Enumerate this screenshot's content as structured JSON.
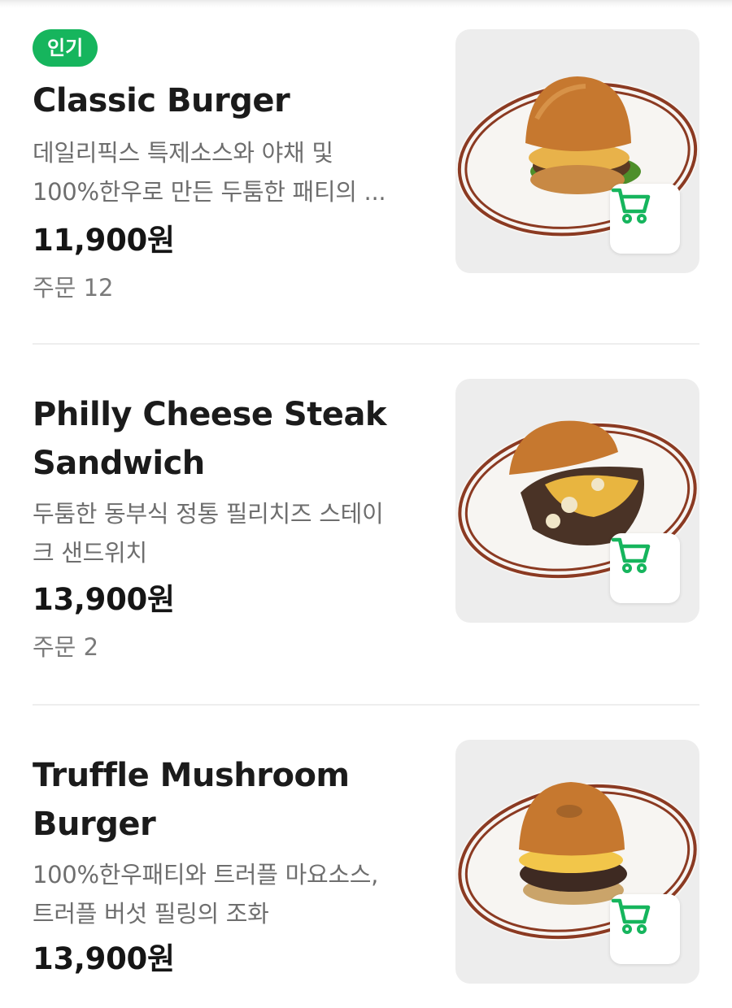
{
  "accent_color": "#16b55d",
  "menu": {
    "items": [
      {
        "badge": "인기",
        "name_lines": [
          "Classic Burger"
        ],
        "desc_lines": [
          "데일리픽스 특제소스와 야채 및",
          "100%한우로 만든 두툼한 패티의 ..."
        ],
        "price": "11,900원",
        "orders": "주문 12",
        "image_icon": "burger-photo",
        "cart_icon": "cart-icon"
      },
      {
        "name_lines": [
          "Philly Cheese Steak",
          "Sandwich"
        ],
        "desc_lines": [
          "두툼한 동부식 정통 필리치즈 스테이",
          "크 샌드위치"
        ],
        "price": "13,900원",
        "orders": "주문 2",
        "image_icon": "sandwich-photo",
        "cart_icon": "cart-icon"
      },
      {
        "name_lines": [
          "Truffle Mushroom",
          "Burger"
        ],
        "desc_lines": [
          "100%한우패티와 트러플 마요소스,",
          "트러플 버섯 필링의 조화"
        ],
        "price": "13,900원",
        "image_icon": "burger-photo",
        "cart_icon": "cart-icon"
      }
    ]
  }
}
